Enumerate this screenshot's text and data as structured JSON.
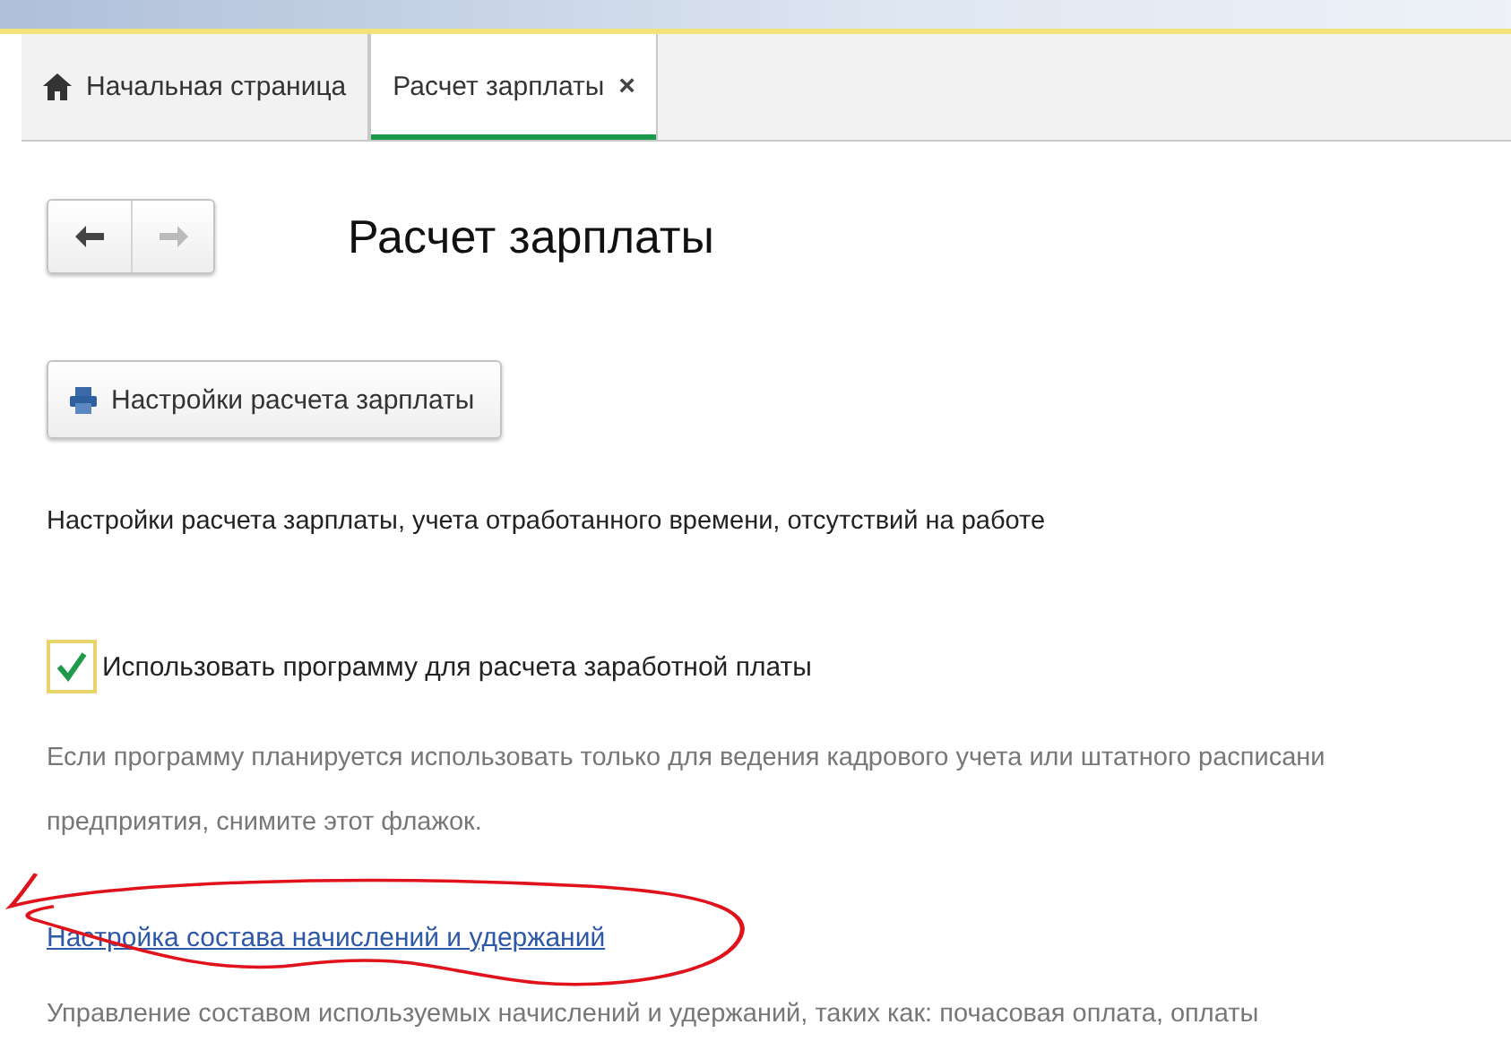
{
  "tabs": [
    {
      "label": "Начальная страница",
      "kind": "home",
      "selected": false
    },
    {
      "label": "Расчет зарплаты",
      "kind": "page",
      "selected": true,
      "close": "×"
    }
  ],
  "page": {
    "title": "Расчет зарплаты",
    "back_disabled": false,
    "forward_disabled": true,
    "settings_button": "Настройки расчета зарплаты",
    "description": "Настройки расчета зарплаты, учета отработанного времени, отсутствий на работе",
    "checkbox": {
      "label": "Использовать программу для расчета заработной платы",
      "checked": true
    },
    "hint": [
      "Если программу планируется использовать только для ведения кадрового учета или штатного расписани",
      "предприятия, снимите этот флажок."
    ],
    "link": "Настройка состава начислений и удержаний",
    "link_note": "Управление составом используемых начислений и удержаний, таких как: почасовая оплата, оплаты"
  }
}
